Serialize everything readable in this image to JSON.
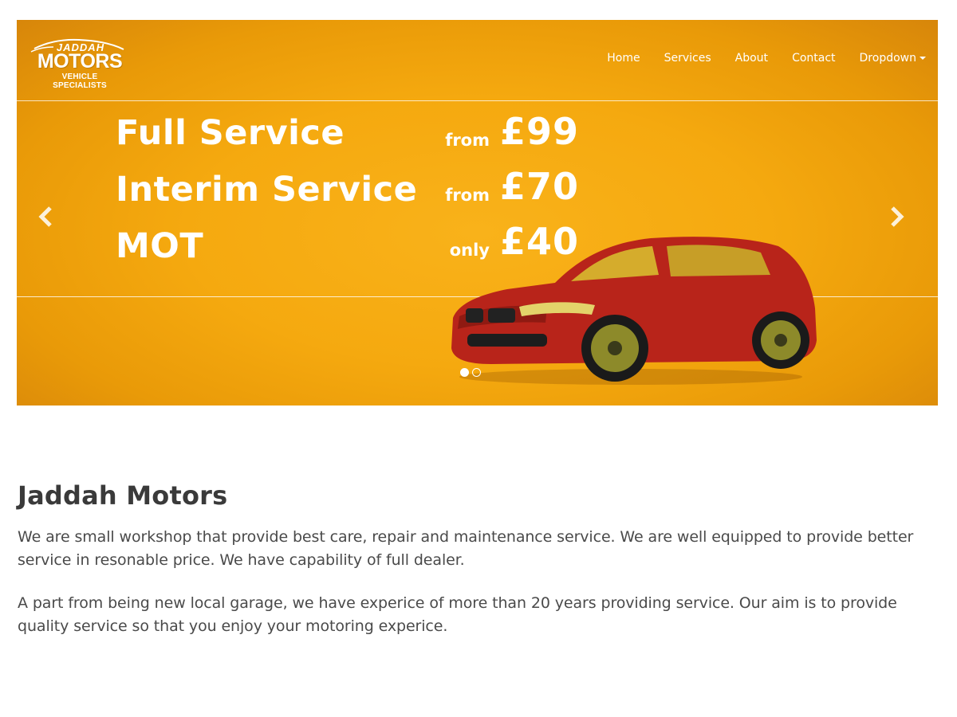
{
  "logo": {
    "top": "JADDAH",
    "main": "MOTORS",
    "sub": "VEHICLE SPECIALISTS"
  },
  "nav": {
    "items": [
      "Home",
      "Services",
      "About",
      "Contact",
      "Dropdown"
    ]
  },
  "carousel": {
    "services": [
      {
        "name": "Full Service",
        "qualifier": "from",
        "price": "£99"
      },
      {
        "name": "Interim Service",
        "qualifier": "from",
        "price": "£70"
      },
      {
        "name": "MOT",
        "qualifier": "only",
        "price": "£40"
      }
    ],
    "prev_icon": "chevron-left-icon",
    "next_icon": "chevron-right-icon",
    "active_slide": 1,
    "slide_count": 2,
    "colors": {
      "background": "#f5a90f",
      "text": "#ffffff",
      "car": "#b8241a"
    }
  },
  "main": {
    "title": "Jaddah Motors",
    "paragraphs": [
      "We are small workshop that provide best care, repair and maintenance service. We are well equipped to provide better service in resonable price. We have capability of full dealer.",
      "A part from being new local garage, we have experice of more than 20 years providing service. Our aim is to provide quality service so that you enjoy your motoring experice."
    ]
  }
}
